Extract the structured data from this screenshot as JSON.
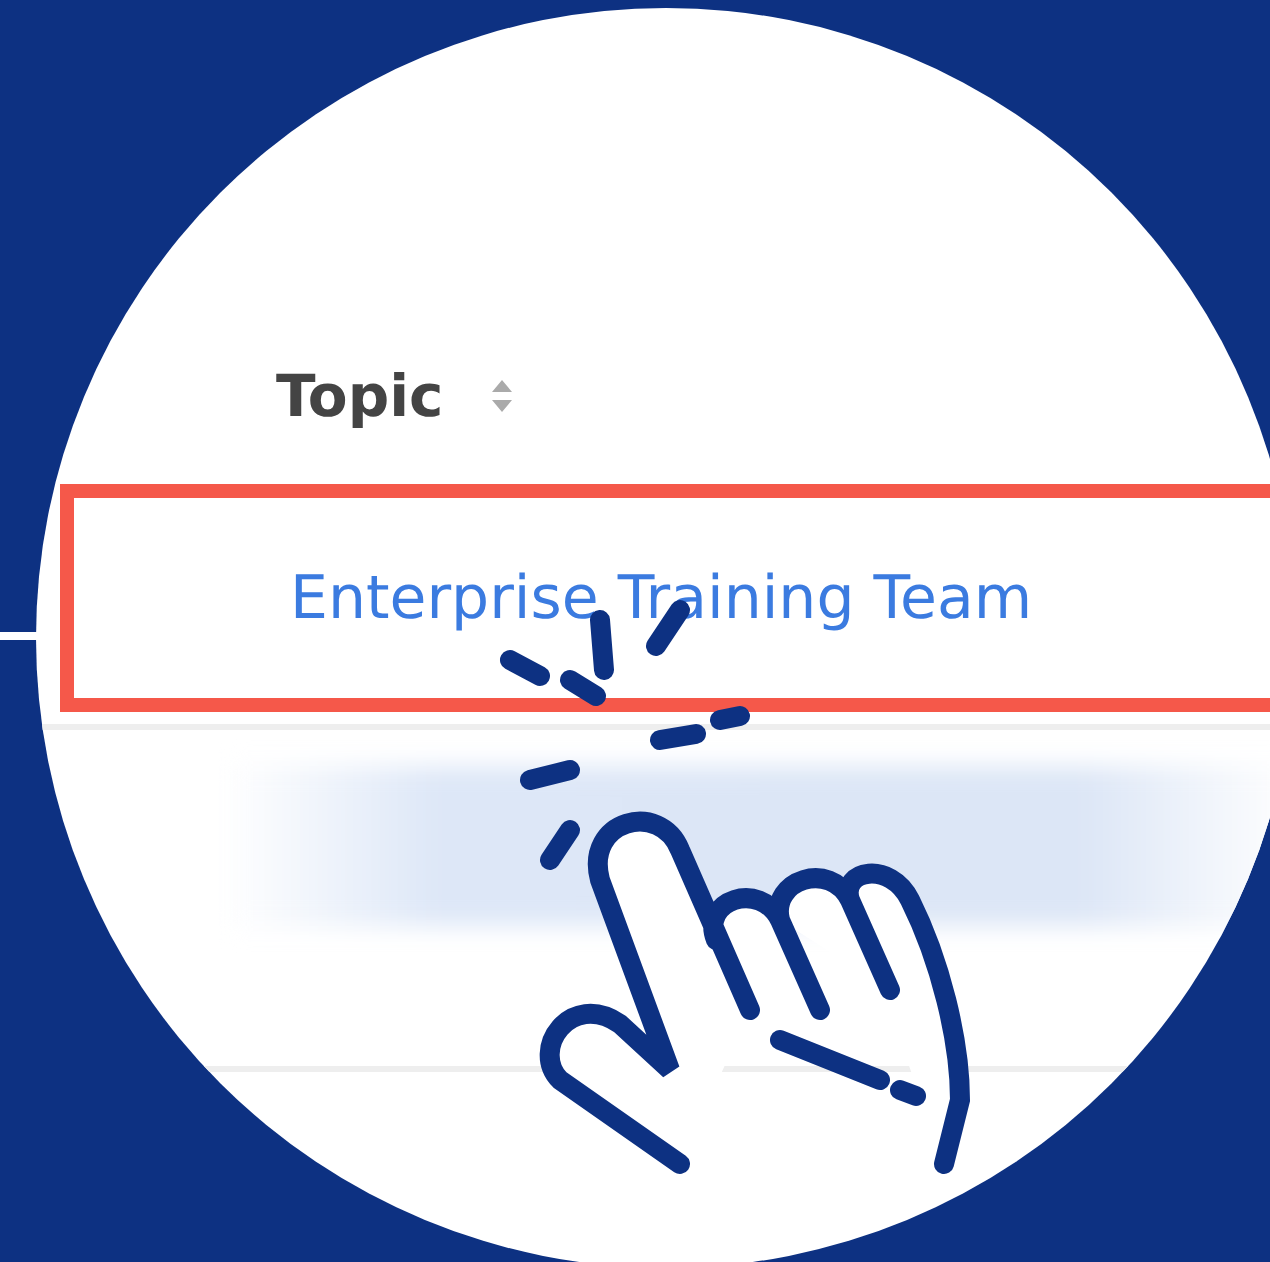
{
  "table": {
    "columns": [
      {
        "label": "Topic",
        "sortable": true
      }
    ],
    "rows": [
      {
        "topic": "Enterprise Training Team",
        "highlighted": true
      }
    ]
  }
}
